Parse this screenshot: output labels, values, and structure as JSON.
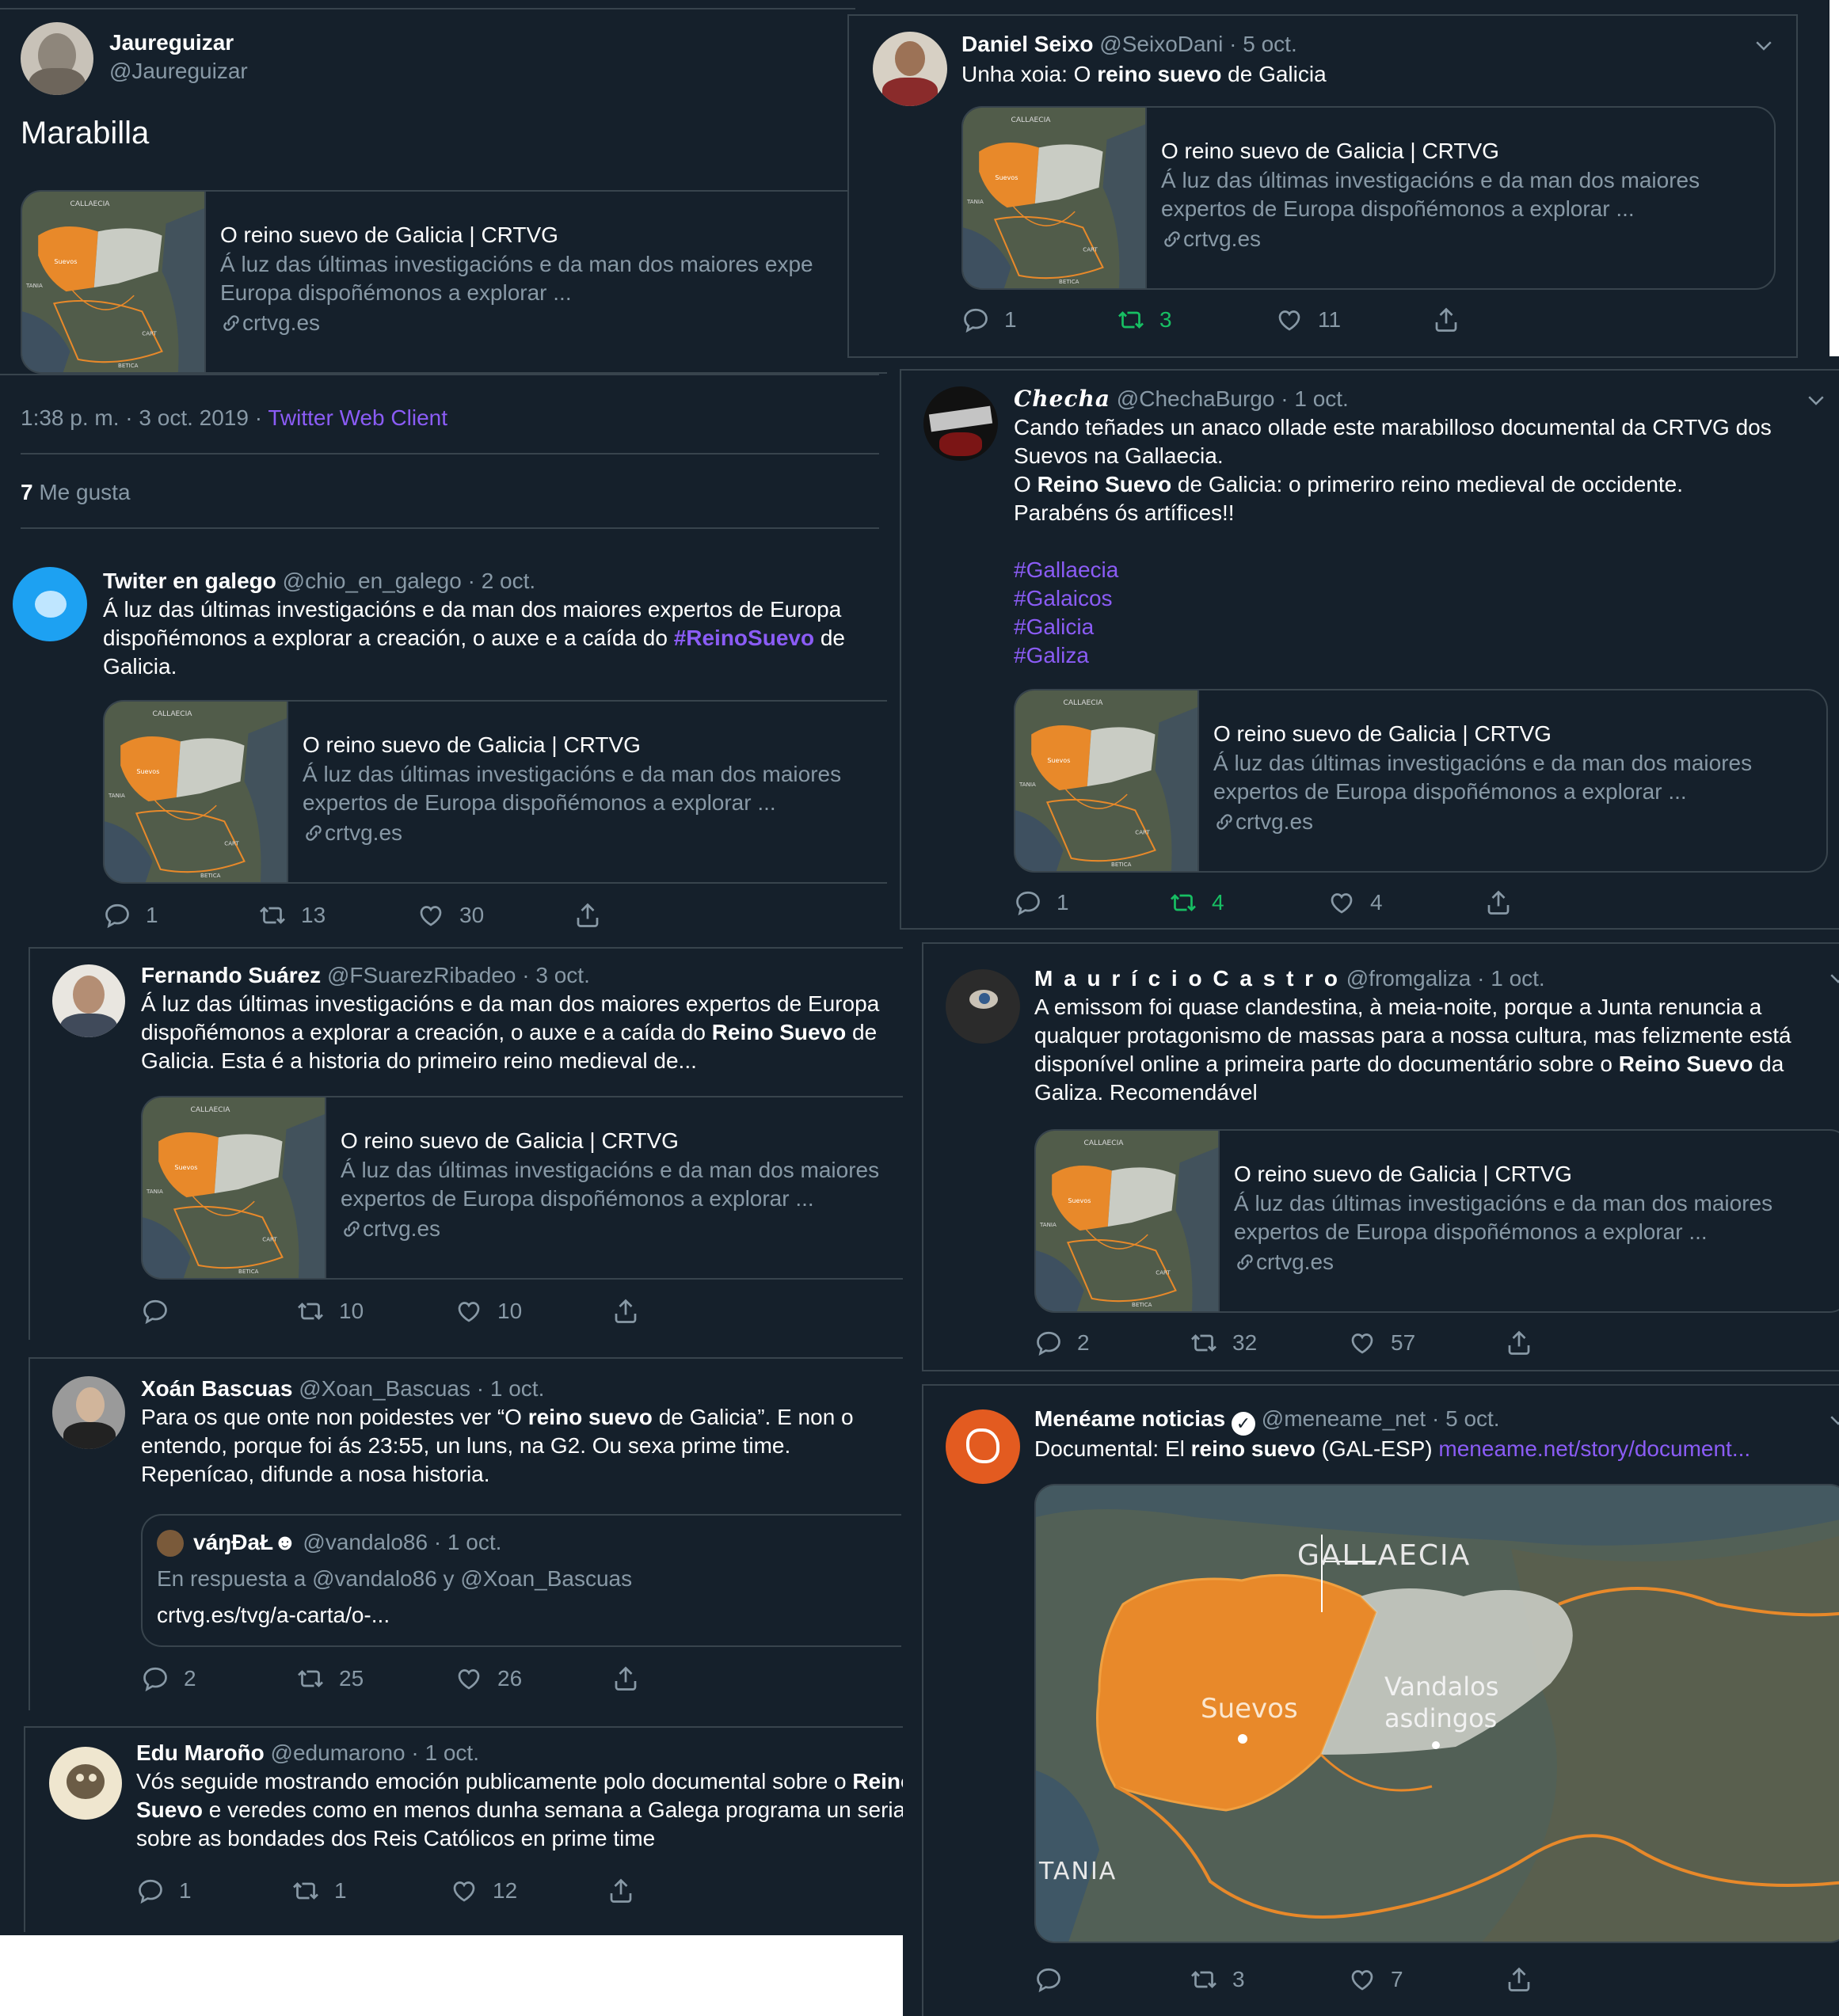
{
  "link_card": {
    "title": "O reino suevo de Galicia | CRTVG",
    "desc": "Á luz das últimas investigacións e da man dos maiores expertos de Europa dispoñémonos a explorar ...",
    "desc_line1_wide": "Á luz das últimas investigacións e da man dos maiores expe",
    "desc_line2_wide": "Europa dispoñémonos a explorar ...",
    "domain": "crtvg.es"
  },
  "main": {
    "name": "Jaureguizar",
    "handle": "@Jaureguizar",
    "text": "Marabilla",
    "time": "1:38 p. m. · 3 oct. 2019 ·",
    "client": "Twitter Web Client",
    "likes_count": "7",
    "likes_label": "Me gusta"
  },
  "twiter": {
    "name": "Twiter en galego",
    "handle": "@chio_en_galego",
    "date": "· 2 oct.",
    "text_a": "Á luz das últimas investigacións e da man dos maiores expertos de Europa dispoñémonos a explorar a creación, o auxe e a caída do ",
    "hashtag": "#ReinoSuevo",
    "text_b": " de Galicia.",
    "replies": "1",
    "retweets": "13",
    "likes": "30"
  },
  "fernando": {
    "name": "Fernando Suárez",
    "handle": "@FSuarezRibadeo",
    "date": "· 3 oct.",
    "text_a": "Á luz das últimas investigacións e da man dos maiores expertos de Europa dispoñémonos a explorar a creación, o auxe e a caída do ",
    "bold": "Reino Suevo",
    "text_b": " de Galicia. Esta é a historia do primeiro reino medieval de...",
    "replies": "",
    "retweets": "10",
    "likes": "10"
  },
  "xoan": {
    "name": "Xoán Bascuas",
    "handle": "@Xoan_Bascuas",
    "date": "· 1 oct.",
    "text_a": "Para os que onte non poidestes ver “O ",
    "bold": "reino suevo",
    "text_b": " de Galicia”. E non o entendo, porque foi ás 23:55, un luns, na G2. Ou sexa prime time. Repenícao, difunde a nosa historia.",
    "quote_name": "váŋÐaŁ☻",
    "quote_handle": "@vandalo86",
    "quote_date": "· 1 oct.",
    "quote_reply": "En respuesta a @vandalo86 y @Xoan_Bascuas",
    "quote_link": "crtvg.es/tvg/a-carta/o-...",
    "replies": "2",
    "retweets": "25",
    "likes": "26"
  },
  "edu": {
    "name": "Edu Maroño",
    "handle": "@edumarono",
    "date": "· 1 oct.",
    "text_a": "Vós seguide mostrando emoción publicamente polo documental sobre o ",
    "bold": "Reino Suevo",
    "text_b": " e veredes como en menos dunha semana a Galega programa un serial sobre as bondades dos Reis Católicos en prime time",
    "replies": "1",
    "retweets": "1",
    "likes": "12"
  },
  "daniel": {
    "name": "Daniel Seixo",
    "handle": "@SeixoDani",
    "date": "· 5 oct.",
    "text_a": "Unha xoia: O ",
    "bold": "reino suevo",
    "text_b": " de Galicia",
    "replies": "1",
    "retweets": "3",
    "likes": "11"
  },
  "checha": {
    "name": "Checha",
    "handle": "@ChechaBurgo",
    "date": "· 1 oct.",
    "text_a": "Cando teñades un anaco ollade este marabilloso documental da CRTVG dos Suevos na Gallaecia.",
    "text_b1": "O ",
    "bold": "Reino Suevo",
    "text_b2": " de Galicia: o primeriro reino medieval de occidente.",
    "text_c": "Parabéns ós artífices!!",
    "hashtags": [
      "#Gallaecia",
      "#Galaicos",
      "#Galicia",
      "#Galiza"
    ],
    "replies": "1",
    "retweets": "4",
    "likes": "4"
  },
  "mauricio": {
    "name": "M a u r í c i o  C a s t r o",
    "handle": "@fromgaliza",
    "date": "· 1 oct.",
    "text_a": "A emissom foi quase clandestina, à meia-noite, porque a Junta renuncia a qualquer protagonismo de massas para a nossa cultura, mas felizmente está disponível online a primeira parte do documentário sobre o ",
    "bold": "Reino Suevo",
    "text_b": " da Galiza. Recomendável",
    "replies": "2",
    "retweets": "32",
    "likes": "57"
  },
  "meneame": {
    "name": "Menéame noticias",
    "handle": "@meneame_net",
    "date": "· 5 oct.",
    "text_a": "Documental: El ",
    "bold": "reino suevo",
    "text_b": " (GAL-ESP) ",
    "link": "meneame.net/story/document...",
    "map_title": "GALLAECIA",
    "map_suevos": "Suevos",
    "map_vandalos": "Vandalos asdingos",
    "map_tania": "TANIA",
    "replies": "",
    "retweets": "3",
    "likes": "7"
  },
  "colors": {
    "bg": "#15202b",
    "border": "#38444d",
    "muted": "#8899a6",
    "link": "#8b5cf6",
    "retweet": "#17bf63",
    "orange": "#e8892a"
  }
}
